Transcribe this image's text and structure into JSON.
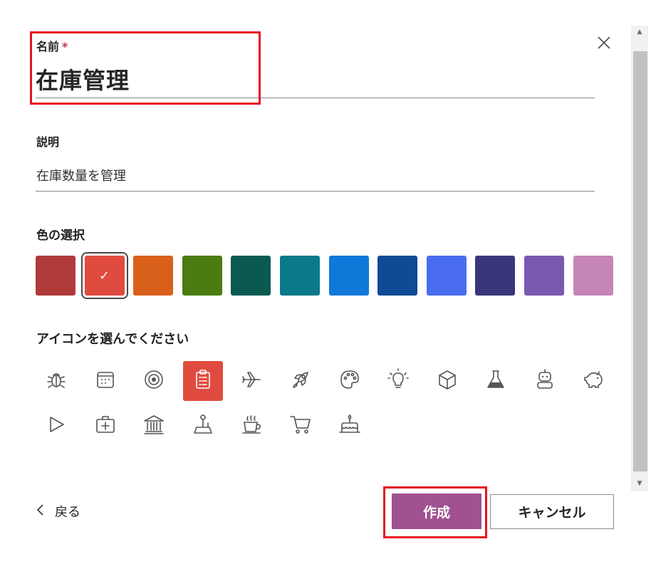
{
  "name_field": {
    "label": "名前",
    "required_mark": "*",
    "value": "在庫管理"
  },
  "description_field": {
    "label": "説明",
    "value": "在庫数量を管理"
  },
  "color_picker": {
    "label": "色の選択",
    "selected_index": 1,
    "check_glyph": "✓",
    "colors": [
      "#b03a3a",
      "#e04b3f",
      "#d9601a",
      "#4a7c12",
      "#0b5a52",
      "#0a7a8a",
      "#0f78d8",
      "#0f4a96",
      "#4a6cf0",
      "#3a367a",
      "#7a59b0",
      "#c585b6"
    ]
  },
  "icon_picker": {
    "label": "アイコンを選んでください",
    "selected_index": 3,
    "icons": [
      "bug-icon",
      "calendar-icon",
      "target-icon",
      "clipboard-icon",
      "airplane-icon",
      "rocket-icon",
      "palette-icon",
      "lightbulb-icon",
      "cube-icon",
      "flask-icon",
      "robot-icon",
      "piggy-bank-icon",
      "play-icon",
      "first-aid-icon",
      "bank-icon",
      "joystick-icon",
      "coffee-icon",
      "cart-icon",
      "cake-icon"
    ]
  },
  "footer": {
    "back_label": "戻る",
    "create_label": "作成",
    "cancel_label": "キャンセル"
  },
  "accent": {
    "create_button": "#a05190",
    "highlight": "#e81123"
  }
}
